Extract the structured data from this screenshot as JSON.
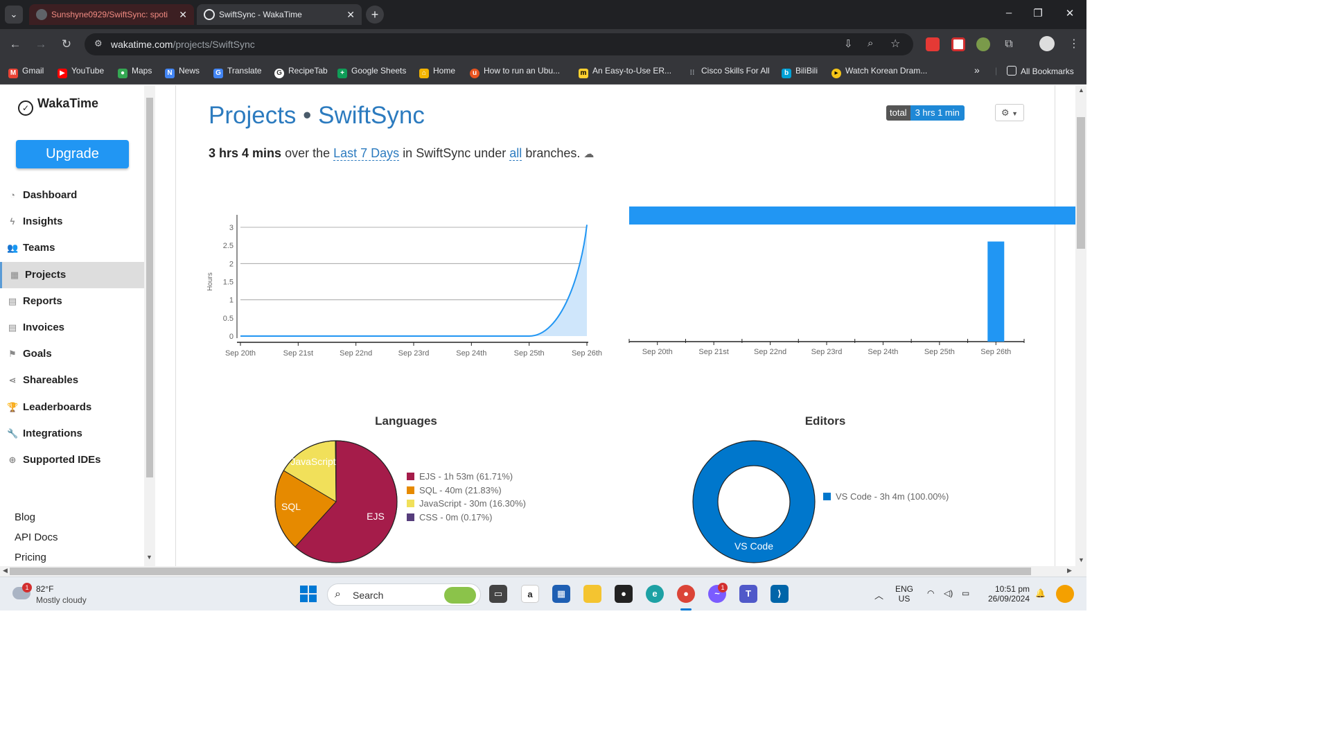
{
  "browser": {
    "tabs": [
      {
        "title": "Sunshyne0929/SwiftSync: spoti",
        "active": false
      },
      {
        "title": "SwiftSync - WakaTime",
        "active": true
      }
    ],
    "url_host": "wakatime.com",
    "url_path": "/projects/SwiftSync",
    "bookmarks": [
      {
        "label": "Gmail",
        "icon": "gmail-icon",
        "color": "#ea4335"
      },
      {
        "label": "YouTube",
        "icon": "youtube-icon",
        "color": "#ff0000"
      },
      {
        "label": "Maps",
        "icon": "maps-icon",
        "color": "#34a853"
      },
      {
        "label": "News",
        "icon": "news-icon",
        "color": "#4285f4"
      },
      {
        "label": "Translate",
        "icon": "translate-icon",
        "color": "#4285f4"
      },
      {
        "label": "RecipeTab",
        "icon": "recipetab-icon",
        "color": "#9aa0a6"
      },
      {
        "label": "Google Sheets",
        "icon": "sheets-icon",
        "color": "#0f9d58"
      },
      {
        "label": "Home",
        "icon": "home-icon",
        "color": "#f4b400"
      },
      {
        "label": "How to run an Ubu...",
        "icon": "ubuntu-icon",
        "color": "#e95420"
      },
      {
        "label": "An Easy-to-Use ER...",
        "icon": "miro-icon",
        "color": "#ffd02f"
      },
      {
        "label": "Cisco Skills For All",
        "icon": "cisco-icon",
        "color": "#1ba0d7"
      },
      {
        "label": "BiliBili",
        "icon": "bilibili-icon",
        "color": "#00a1d6"
      },
      {
        "label": "Watch Korean Dram...",
        "icon": "play-icon",
        "color": "#f5c518"
      }
    ],
    "all_bookmarks": "All Bookmarks"
  },
  "sidebar": {
    "brand": "WakaTime",
    "upgrade": "Upgrade",
    "items": [
      {
        "label": "Dashboard",
        "icon": "dashboard-icon",
        "glyph": "◔"
      },
      {
        "label": "Insights",
        "icon": "bolt-icon",
        "glyph": "ϟ"
      },
      {
        "label": "Teams",
        "icon": "users-icon",
        "glyph": "👥"
      },
      {
        "label": "Projects",
        "icon": "grid-icon",
        "glyph": "▦",
        "active": true
      },
      {
        "label": "Reports",
        "icon": "file-icon",
        "glyph": "▤"
      },
      {
        "label": "Invoices",
        "icon": "invoice-icon",
        "glyph": "▤"
      },
      {
        "label": "Goals",
        "icon": "flag-icon",
        "glyph": "⚑"
      },
      {
        "label": "Shareables",
        "icon": "share-icon",
        "glyph": "⋖"
      },
      {
        "label": "Leaderboards",
        "icon": "trophy-icon",
        "glyph": "🏆"
      },
      {
        "label": "Integrations",
        "icon": "wrench-icon",
        "glyph": "🔧"
      },
      {
        "label": "Supported IDEs",
        "icon": "plus-circle-icon",
        "glyph": "⊕"
      }
    ],
    "links": [
      "Blog",
      "API Docs",
      "Pricing"
    ]
  },
  "header": {
    "title_prefix": "Projects",
    "separator": "•",
    "project": "SwiftSync",
    "total_label": "total",
    "total_value": "3 hrs 1 min"
  },
  "summary": {
    "time": "3 hrs 4 mins",
    "t1": "over the",
    "range": "Last 7 Days",
    "t2": "in SwiftSync under",
    "branches": "all",
    "t3": "branches."
  },
  "chart_data": [
    {
      "type": "area",
      "ylabel": "Hours",
      "ylim": [
        0,
        3
      ],
      "yticks": [
        "0",
        "0.5",
        "1",
        "1.5",
        "2",
        "2.5",
        "3"
      ],
      "categories": [
        "Sep 20th",
        "Sep 21st",
        "Sep 22nd",
        "Sep 23rd",
        "Sep 24th",
        "Sep 25th",
        "Sep 26th"
      ],
      "values": [
        0,
        0,
        0,
        0,
        0,
        0,
        3.07
      ],
      "color": "#2196f3"
    },
    {
      "type": "bar",
      "categories": [
        "Sep 20th",
        "Sep 21st",
        "Sep 22nd",
        "Sep 23rd",
        "Sep 24th",
        "Sep 25th",
        "Sep 26th"
      ],
      "values": [
        0,
        0,
        0,
        0,
        0,
        0,
        3.07
      ],
      "ylim": [
        0,
        3.4
      ],
      "color": "#2196f3"
    },
    {
      "type": "pie",
      "title": "Languages",
      "slices": [
        {
          "name": "EJS",
          "value": 61.71,
          "legend": "EJS - 1h 53m (61.71%)",
          "color": "#a51c4a"
        },
        {
          "name": "SQL",
          "value": 21.83,
          "legend": "SQL - 40m (21.83%)",
          "color": "#e68a00"
        },
        {
          "name": "JavaScript",
          "value": 16.3,
          "legend": "JavaScript - 30m (16.30%)",
          "color": "#f1e05a"
        },
        {
          "name": "CSS",
          "value": 0.17,
          "legend": "CSS - 0m (0.17%)",
          "color": "#563d7c"
        }
      ]
    },
    {
      "type": "pie",
      "title": "Editors",
      "slices": [
        {
          "name": "VS Code",
          "value": 100.0,
          "legend": "VS Code - 3h 4m (100.00%)",
          "color": "#0077cc"
        }
      ]
    }
  ],
  "taskbar": {
    "temp": "82°F",
    "condition": "Mostly cloudy",
    "weather_badge": "1",
    "search": "Search",
    "messenger_badge": "1",
    "lang": "ENG",
    "region": "US",
    "time": "10:51 pm",
    "date": "26/09/2024"
  }
}
